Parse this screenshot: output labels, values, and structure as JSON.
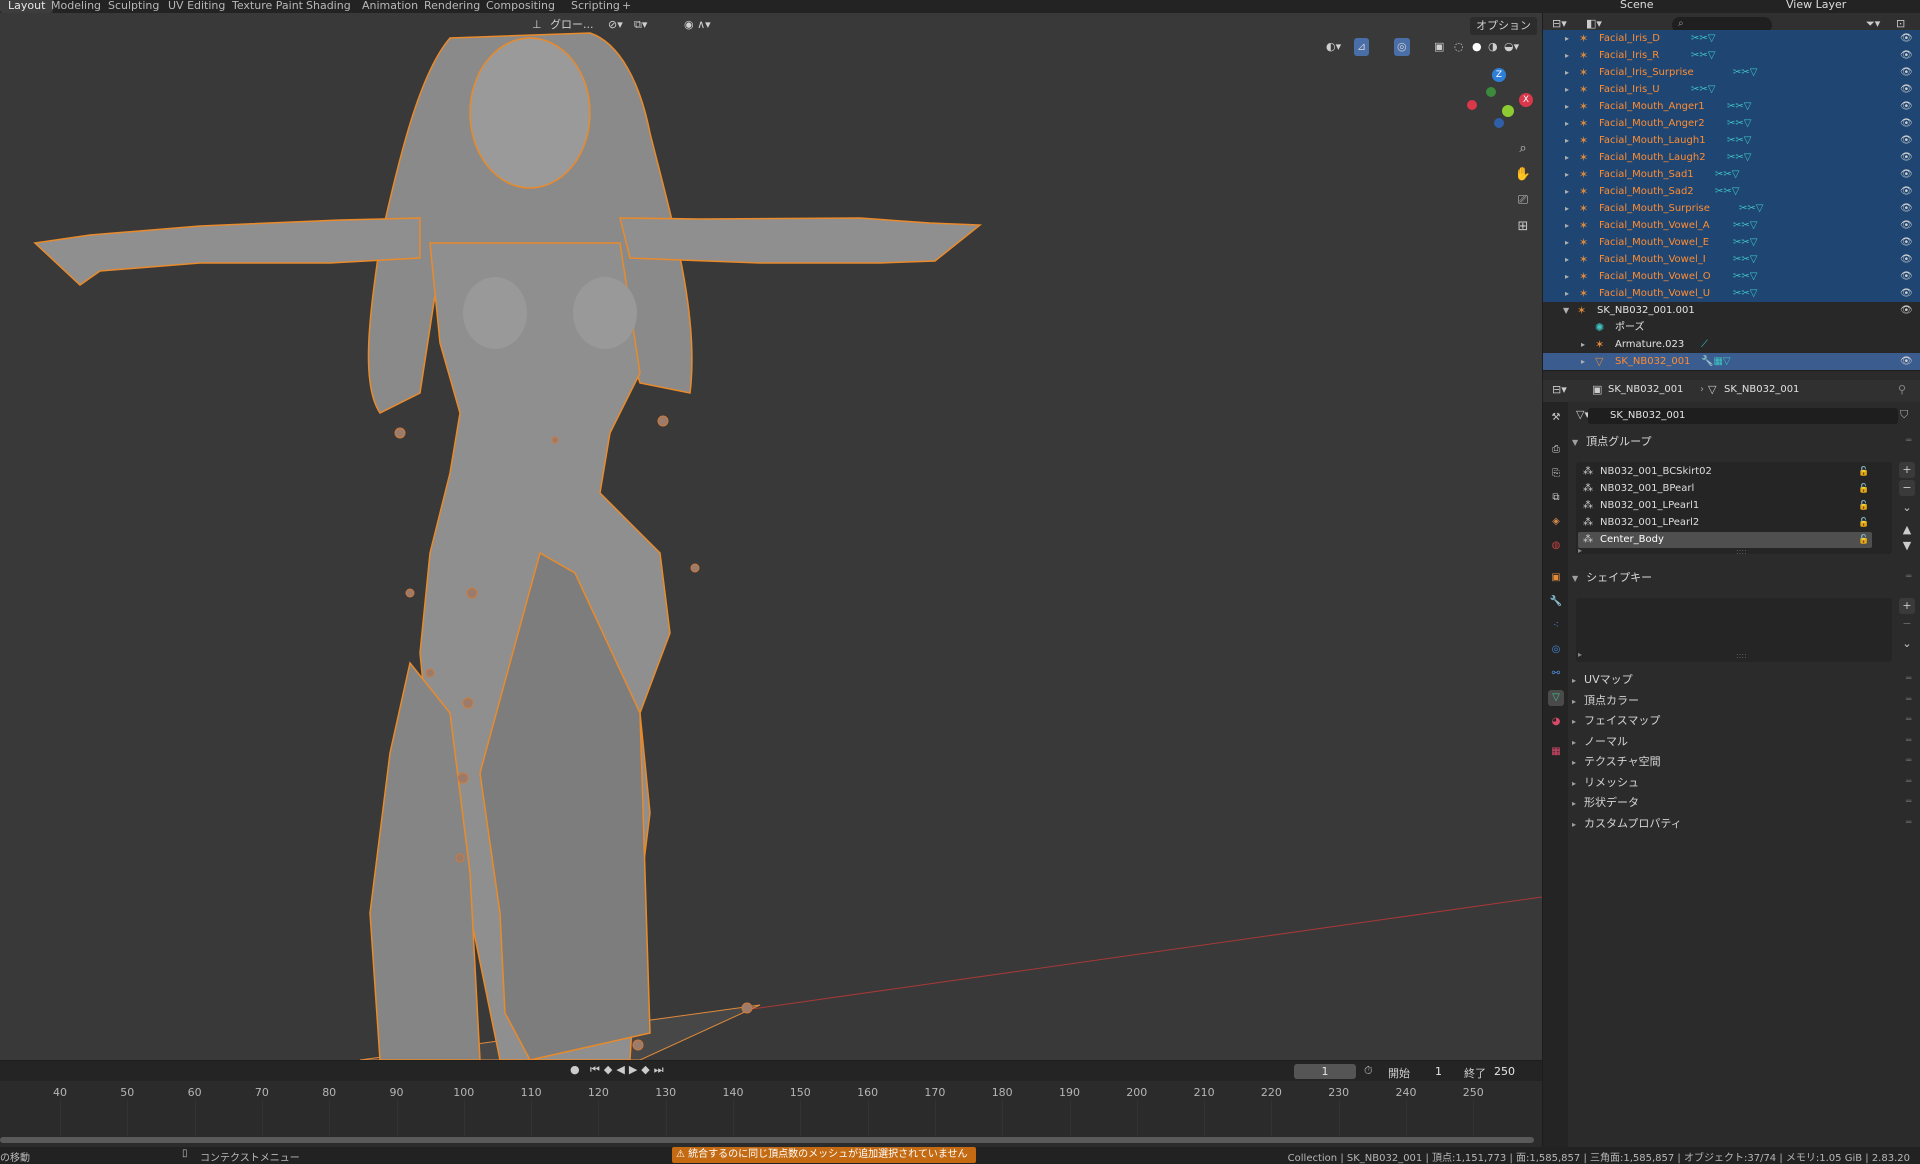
{
  "workspaces": [
    "Layout",
    "Modeling",
    "Sculpting",
    "UV Editing",
    "Texture Paint",
    "Shading",
    "Animation",
    "Rendering",
    "Compositing",
    "Scripting",
    "+"
  ],
  "active_workspace": "Layout",
  "scene": "Scene",
  "view_layer": "View Layer",
  "viewport": {
    "transform_orientation": "グロー...",
    "options_label": "オプション",
    "gizmo": {
      "z": "Z",
      "x": "X"
    }
  },
  "outliner": {
    "rows": [
      {
        "label": "Facial_Iris_D",
        "style": "orange",
        "selected": true,
        "mods": "✂✂▽"
      },
      {
        "label": "Facial_Iris_R",
        "style": "orange",
        "selected": true,
        "mods": "✂✂▽"
      },
      {
        "label": "Facial_Iris_Surprise",
        "style": "orange",
        "selected": true,
        "mods": "✂✂▽"
      },
      {
        "label": "Facial_Iris_U",
        "style": "orange",
        "selected": true,
        "mods": "✂✂▽"
      },
      {
        "label": "Facial_Mouth_Anger1",
        "style": "orange",
        "selected": true,
        "mods": "✂✂▽"
      },
      {
        "label": "Facial_Mouth_Anger2",
        "style": "orange",
        "selected": true,
        "mods": "✂✂▽"
      },
      {
        "label": "Facial_Mouth_Laugh1",
        "style": "orange",
        "selected": true,
        "mods": "✂✂▽"
      },
      {
        "label": "Facial_Mouth_Laugh2",
        "style": "orange",
        "selected": true,
        "mods": "✂✂▽"
      },
      {
        "label": "Facial_Mouth_Sad1",
        "style": "orange",
        "selected": true,
        "mods": "✂✂▽"
      },
      {
        "label": "Facial_Mouth_Sad2",
        "style": "orange",
        "selected": true,
        "mods": "✂✂▽"
      },
      {
        "label": "Facial_Mouth_Surprise",
        "style": "orange",
        "selected": true,
        "mods": "✂✂▽"
      },
      {
        "label": "Facial_Mouth_Vowel_A",
        "style": "orange",
        "selected": true,
        "mods": "✂✂▽"
      },
      {
        "label": "Facial_Mouth_Vowel_E",
        "style": "orange",
        "selected": true,
        "mods": "✂✂▽"
      },
      {
        "label": "Facial_Mouth_Vowel_I",
        "style": "orange",
        "selected": true,
        "mods": "✂✂▽"
      },
      {
        "label": "Facial_Mouth_Vowel_O",
        "style": "orange",
        "selected": true,
        "mods": "✂✂▽"
      },
      {
        "label": "Facial_Mouth_Vowel_U",
        "style": "orange",
        "selected": true,
        "mods": "✂✂▽"
      },
      {
        "label": "SK_NB032_001.001",
        "style": "white",
        "selected": false,
        "mods": ""
      },
      {
        "label": "ポーズ",
        "style": "white",
        "selected": false,
        "mods": ""
      },
      {
        "label": "Armature.023",
        "style": "white",
        "selected": false,
        "mods": "⟋"
      },
      {
        "label": "SK_NB032_001",
        "style": "orange",
        "selected": true,
        "active": true,
        "mods": "🔧▦▽"
      }
    ]
  },
  "properties": {
    "breadcrumb_object": "SK_NB032_001",
    "breadcrumb_mesh": "SK_NB032_001",
    "mesh_name": "SK_NB032_001",
    "vertex_groups_title": "頂点グループ",
    "vertex_groups": [
      "NB032_001_BCSkirt02",
      "NB032_001_BPearl",
      "NB032_001_LPearl1",
      "NB032_001_LPearl2",
      "Center_Body"
    ],
    "active_vertex_group": "Center_Body",
    "shape_keys_title": "シェイプキー",
    "sections": [
      "UVマップ",
      "頂点カラー",
      "フェイスマップ",
      "ノーマル",
      "テクスチャ空間",
      "リメッシュ",
      "形状データ",
      "カスタムプロパティ"
    ]
  },
  "timeline": {
    "current_frame": "1",
    "start_label": "開始",
    "start": "1",
    "end_label": "終了",
    "end": "250",
    "ticks": [
      "40",
      "50",
      "60",
      "70",
      "80",
      "90",
      "100",
      "110",
      "120",
      "130",
      "140",
      "150",
      "160",
      "170",
      "180",
      "190",
      "200",
      "210",
      "220",
      "230",
      "240",
      "250"
    ]
  },
  "statusbar": {
    "left": "の移動",
    "context_menu": "コンテクストメニュー",
    "warning": "統合するのに同じ頂点数のメッシュが追加選択されていません",
    "info": "Collection | SK_NB032_001 | 頂点:1,151,773 | 面:1,585,857 | 三角面:1,585,857 | オブジェクト:37/74 | メモリ:1.05 GiB | 2.83.20"
  },
  "colors": {
    "accent_selected": "#1f4673",
    "accent_active": "#3a5c8e",
    "object_orange": "#ff8c31",
    "modifier_teal": "#3fc3c3",
    "warning": "#c36a12",
    "viewport_bg": "#393939"
  }
}
